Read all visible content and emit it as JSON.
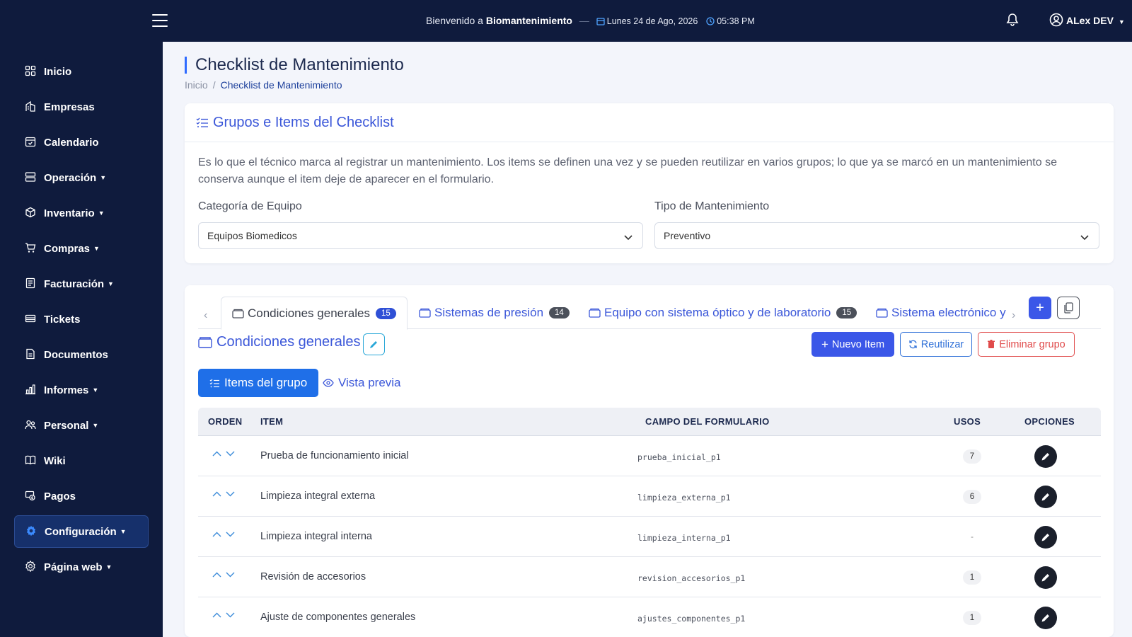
{
  "header": {
    "welcome_prefix": "Bienvenido a",
    "app_name": "Biomantenimiento",
    "date": "Lunes 24 de Ago, 2026",
    "time": "05:38 PM",
    "user_name": "ALex DEV"
  },
  "sidebar": {
    "items": [
      {
        "label": "Inicio",
        "icon": "grid-icon",
        "caret": false
      },
      {
        "label": "Empresas",
        "icon": "building-icon",
        "caret": false
      },
      {
        "label": "Calendario",
        "icon": "calendar-check-icon",
        "caret": false
      },
      {
        "label": "Operación",
        "icon": "server-icon",
        "caret": true
      },
      {
        "label": "Inventario",
        "icon": "box-icon",
        "caret": true
      },
      {
        "label": "Compras",
        "icon": "cart-icon",
        "caret": true
      },
      {
        "label": "Facturación",
        "icon": "receipt-icon",
        "caret": true
      },
      {
        "label": "Tickets",
        "icon": "ticket-icon",
        "caret": false
      },
      {
        "label": "Documentos",
        "icon": "document-icon",
        "caret": false
      },
      {
        "label": "Informes",
        "icon": "bar-chart-icon",
        "caret": true
      },
      {
        "label": "Personal",
        "icon": "people-icon",
        "caret": true
      },
      {
        "label": "Wiki",
        "icon": "book-icon",
        "caret": false
      },
      {
        "label": "Pagos",
        "icon": "cash-icon",
        "caret": false
      },
      {
        "label": "Configuración",
        "icon": "gear-fill-icon",
        "caret": true,
        "active": true
      },
      {
        "label": "Página web",
        "icon": "gear-icon",
        "caret": true
      }
    ]
  },
  "page": {
    "title": "Checklist de Mantenimiento",
    "breadcrumb": [
      "Inicio",
      "Checklist de Mantenimiento"
    ]
  },
  "filters_card": {
    "title": "Grupos e Items del Checklist",
    "description": "Es lo que el técnico marca al registrar un mantenimiento. Los items se definen una vez y se pueden reutilizar en varios grupos; lo que ya se marcó en un mantenimiento se conserva aunque el item deje de aparecer en el formulario.",
    "category_label": "Categoría de Equipo",
    "category_value": "Equipos Biomedicos",
    "type_label": "Tipo de Mantenimiento",
    "type_value": "Preventivo"
  },
  "group_tabs": [
    {
      "label": "Condiciones generales",
      "count": "15",
      "active": true
    },
    {
      "label": "Sistemas de presión",
      "count": "14"
    },
    {
      "label": "Equipo con sistema óptico y de laboratorio",
      "count": "15"
    },
    {
      "label": "Sistema electrónico y"
    }
  ],
  "group": {
    "title": "Condiciones generales",
    "new_item": "Nuevo Item",
    "reuse": "Reutilizar",
    "delete_group": "Eliminar grupo",
    "subtab_items": "Items del grupo",
    "subtab_preview": "Vista previa"
  },
  "table": {
    "headers": {
      "order": "ORDEN",
      "item": "ITEM",
      "field": "CAMPO DEL FORMULARIO",
      "uses": "USOS",
      "options": "OPCIONES"
    },
    "rows": [
      {
        "item": "Prueba de funcionamiento inicial",
        "field": "prueba_inicial_p1",
        "uses": "7"
      },
      {
        "item": "Limpieza integral externa",
        "field": "limpieza_externa_p1",
        "uses": "6"
      },
      {
        "item": "Limpieza integral interna",
        "field": "limpieza_interna_p1",
        "uses": "-"
      },
      {
        "item": "Revisión de accesorios",
        "field": "revision_accesorios_p1",
        "uses": "1"
      },
      {
        "item": "Ajuste de componentes generales",
        "field": "ajustes_componentes_p1",
        "uses": "1"
      }
    ]
  },
  "colors": {
    "navy": "#0f1b3d",
    "accent": "#3b57e8",
    "danger": "#e04b4b"
  }
}
